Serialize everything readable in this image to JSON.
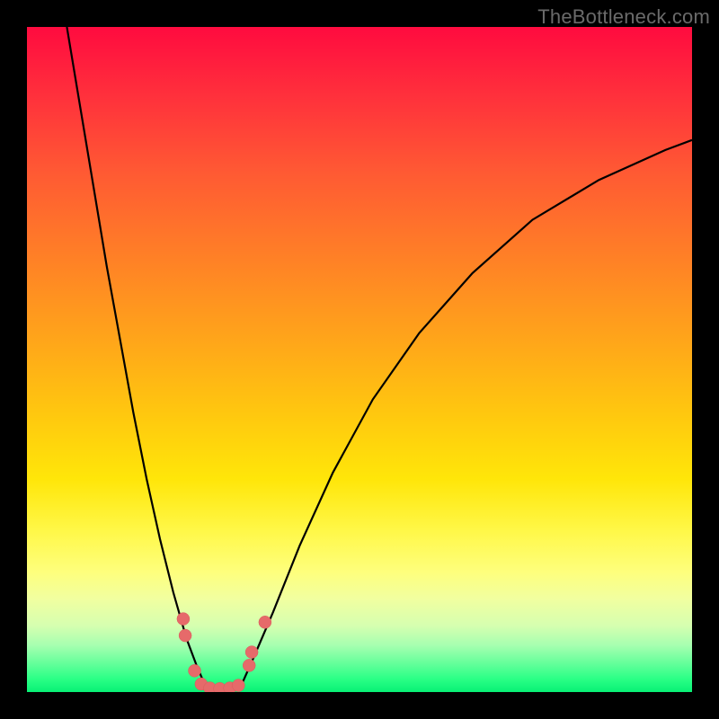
{
  "watermark": "TheBottleneck.com",
  "colors": {
    "background": "#000000",
    "curve": "#000000",
    "marker": "#E66A6A"
  },
  "chart_data": {
    "type": "line",
    "title": "",
    "xlabel": "",
    "ylabel": "",
    "xlim": [
      0,
      100
    ],
    "ylim": [
      0,
      100
    ],
    "background_gradient": {
      "top": "#ff0b3f",
      "bottom": "#08f175",
      "description": "vertical rainbow gradient red→orange→yellow→green indicating bottleneck severity",
      "meaning_top": "bad / high bottleneck",
      "meaning_bottom": "good / no bottleneck"
    },
    "series": [
      {
        "name": "left-branch",
        "description": "steep descending curve from top-left down to valley",
        "x": [
          6,
          8,
          10,
          12,
          14,
          16,
          18,
          20,
          22,
          24,
          25.5,
          27
        ],
        "y": [
          100,
          88,
          76,
          64,
          53,
          42,
          32,
          23,
          15,
          8,
          4,
          0.5
        ]
      },
      {
        "name": "right-branch",
        "description": "curve rising from valley toward upper-right, flattening",
        "x": [
          32,
          34,
          37,
          41,
          46,
          52,
          59,
          67,
          76,
          86,
          96,
          100
        ],
        "y": [
          0.5,
          5,
          12,
          22,
          33,
          44,
          54,
          63,
          71,
          77,
          81.5,
          83
        ]
      },
      {
        "name": "valley-floor",
        "description": "flat green optimum zone between branches",
        "x": [
          27,
          32
        ],
        "y": [
          0.5,
          0.5
        ]
      }
    ],
    "markers": {
      "name": "datapoints",
      "description": "pink/salmon circular markers clustered around the valley minimum",
      "points": [
        {
          "x": 23.5,
          "y": 11
        },
        {
          "x": 23.8,
          "y": 8.5
        },
        {
          "x": 25.2,
          "y": 3.2
        },
        {
          "x": 26.2,
          "y": 1.2
        },
        {
          "x": 27.5,
          "y": 0.6
        },
        {
          "x": 29.0,
          "y": 0.5
        },
        {
          "x": 30.5,
          "y": 0.6
        },
        {
          "x": 31.8,
          "y": 1.0
        },
        {
          "x": 33.4,
          "y": 4.0
        },
        {
          "x": 33.8,
          "y": 6.0
        },
        {
          "x": 35.8,
          "y": 10.5
        }
      ],
      "radius_px": 7
    }
  }
}
